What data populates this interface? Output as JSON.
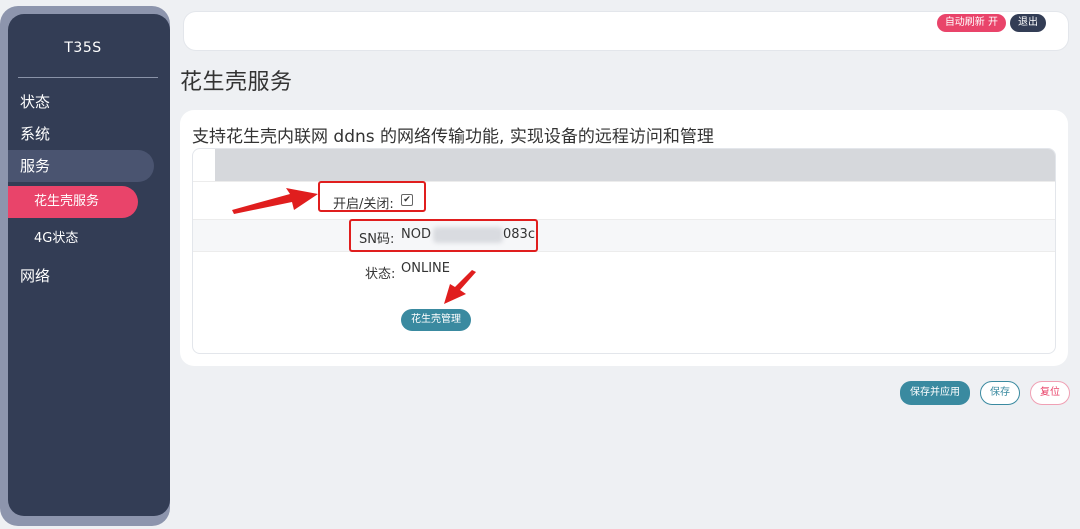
{
  "sidebar": {
    "brand": "T35S",
    "items": [
      {
        "label": "状态"
      },
      {
        "label": "系统"
      },
      {
        "label": "服务"
      },
      {
        "label": "网络"
      }
    ],
    "sub_items": [
      {
        "label": "花生壳服务"
      },
      {
        "label": "4G状态"
      }
    ]
  },
  "topbar": {
    "auto_refresh": "自动刷新 开",
    "logout": "退出"
  },
  "page": {
    "title": "花生壳服务",
    "description": "支持花生壳内联网 ddns 的网络传输功能, 实现设备的远程访问和管理"
  },
  "form": {
    "enable_label": "开启/关闭:",
    "enable_checked": "✔",
    "sn_label": "SN码:",
    "sn_value_prefix": "NOD",
    "sn_value_suffix": "083c",
    "status_label": "状态:",
    "status_value": "ONLINE",
    "manage_button": "花生壳管理"
  },
  "actions": {
    "save_apply": "保存并应用",
    "save": "保存",
    "reset": "复位"
  },
  "colors": {
    "sidebar_bg": "#333d55",
    "accent_pink": "#e9446a",
    "teal": "#3a8aa0",
    "annotation_red": "#e01e1e"
  }
}
